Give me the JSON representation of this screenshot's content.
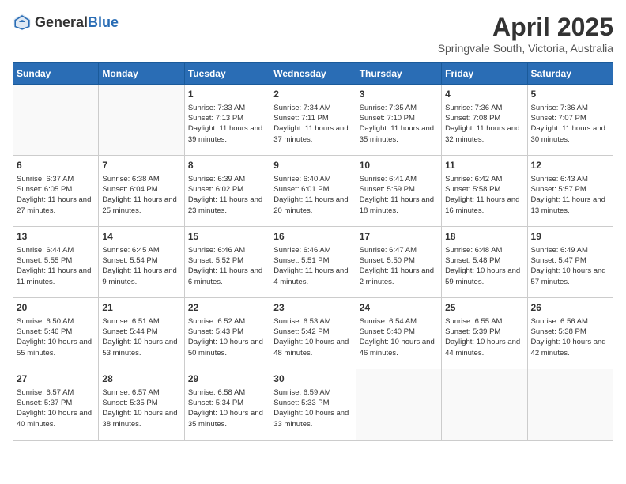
{
  "header": {
    "logo_general": "General",
    "logo_blue": "Blue",
    "month_title": "April 2025",
    "subtitle": "Springvale South, Victoria, Australia"
  },
  "days_of_week": [
    "Sunday",
    "Monday",
    "Tuesday",
    "Wednesday",
    "Thursday",
    "Friday",
    "Saturday"
  ],
  "weeks": [
    [
      {
        "day": "",
        "sunrise": "",
        "sunset": "",
        "daylight": "",
        "empty": true
      },
      {
        "day": "",
        "sunrise": "",
        "sunset": "",
        "daylight": "",
        "empty": true
      },
      {
        "day": "1",
        "sunrise": "Sunrise: 7:33 AM",
        "sunset": "Sunset: 7:13 PM",
        "daylight": "Daylight: 11 hours and 39 minutes.",
        "empty": false
      },
      {
        "day": "2",
        "sunrise": "Sunrise: 7:34 AM",
        "sunset": "Sunset: 7:11 PM",
        "daylight": "Daylight: 11 hours and 37 minutes.",
        "empty": false
      },
      {
        "day": "3",
        "sunrise": "Sunrise: 7:35 AM",
        "sunset": "Sunset: 7:10 PM",
        "daylight": "Daylight: 11 hours and 35 minutes.",
        "empty": false
      },
      {
        "day": "4",
        "sunrise": "Sunrise: 7:36 AM",
        "sunset": "Sunset: 7:08 PM",
        "daylight": "Daylight: 11 hours and 32 minutes.",
        "empty": false
      },
      {
        "day": "5",
        "sunrise": "Sunrise: 7:36 AM",
        "sunset": "Sunset: 7:07 PM",
        "daylight": "Daylight: 11 hours and 30 minutes.",
        "empty": false
      }
    ],
    [
      {
        "day": "6",
        "sunrise": "Sunrise: 6:37 AM",
        "sunset": "Sunset: 6:05 PM",
        "daylight": "Daylight: 11 hours and 27 minutes.",
        "empty": false
      },
      {
        "day": "7",
        "sunrise": "Sunrise: 6:38 AM",
        "sunset": "Sunset: 6:04 PM",
        "daylight": "Daylight: 11 hours and 25 minutes.",
        "empty": false
      },
      {
        "day": "8",
        "sunrise": "Sunrise: 6:39 AM",
        "sunset": "Sunset: 6:02 PM",
        "daylight": "Daylight: 11 hours and 23 minutes.",
        "empty": false
      },
      {
        "day": "9",
        "sunrise": "Sunrise: 6:40 AM",
        "sunset": "Sunset: 6:01 PM",
        "daylight": "Daylight: 11 hours and 20 minutes.",
        "empty": false
      },
      {
        "day": "10",
        "sunrise": "Sunrise: 6:41 AM",
        "sunset": "Sunset: 5:59 PM",
        "daylight": "Daylight: 11 hours and 18 minutes.",
        "empty": false
      },
      {
        "day": "11",
        "sunrise": "Sunrise: 6:42 AM",
        "sunset": "Sunset: 5:58 PM",
        "daylight": "Daylight: 11 hours and 16 minutes.",
        "empty": false
      },
      {
        "day": "12",
        "sunrise": "Sunrise: 6:43 AM",
        "sunset": "Sunset: 5:57 PM",
        "daylight": "Daylight: 11 hours and 13 minutes.",
        "empty": false
      }
    ],
    [
      {
        "day": "13",
        "sunrise": "Sunrise: 6:44 AM",
        "sunset": "Sunset: 5:55 PM",
        "daylight": "Daylight: 11 hours and 11 minutes.",
        "empty": false
      },
      {
        "day": "14",
        "sunrise": "Sunrise: 6:45 AM",
        "sunset": "Sunset: 5:54 PM",
        "daylight": "Daylight: 11 hours and 9 minutes.",
        "empty": false
      },
      {
        "day": "15",
        "sunrise": "Sunrise: 6:46 AM",
        "sunset": "Sunset: 5:52 PM",
        "daylight": "Daylight: 11 hours and 6 minutes.",
        "empty": false
      },
      {
        "day": "16",
        "sunrise": "Sunrise: 6:46 AM",
        "sunset": "Sunset: 5:51 PM",
        "daylight": "Daylight: 11 hours and 4 minutes.",
        "empty": false
      },
      {
        "day": "17",
        "sunrise": "Sunrise: 6:47 AM",
        "sunset": "Sunset: 5:50 PM",
        "daylight": "Daylight: 11 hours and 2 minutes.",
        "empty": false
      },
      {
        "day": "18",
        "sunrise": "Sunrise: 6:48 AM",
        "sunset": "Sunset: 5:48 PM",
        "daylight": "Daylight: 10 hours and 59 minutes.",
        "empty": false
      },
      {
        "day": "19",
        "sunrise": "Sunrise: 6:49 AM",
        "sunset": "Sunset: 5:47 PM",
        "daylight": "Daylight: 10 hours and 57 minutes.",
        "empty": false
      }
    ],
    [
      {
        "day": "20",
        "sunrise": "Sunrise: 6:50 AM",
        "sunset": "Sunset: 5:46 PM",
        "daylight": "Daylight: 10 hours and 55 minutes.",
        "empty": false
      },
      {
        "day": "21",
        "sunrise": "Sunrise: 6:51 AM",
        "sunset": "Sunset: 5:44 PM",
        "daylight": "Daylight: 10 hours and 53 minutes.",
        "empty": false
      },
      {
        "day": "22",
        "sunrise": "Sunrise: 6:52 AM",
        "sunset": "Sunset: 5:43 PM",
        "daylight": "Daylight: 10 hours and 50 minutes.",
        "empty": false
      },
      {
        "day": "23",
        "sunrise": "Sunrise: 6:53 AM",
        "sunset": "Sunset: 5:42 PM",
        "daylight": "Daylight: 10 hours and 48 minutes.",
        "empty": false
      },
      {
        "day": "24",
        "sunrise": "Sunrise: 6:54 AM",
        "sunset": "Sunset: 5:40 PM",
        "daylight": "Daylight: 10 hours and 46 minutes.",
        "empty": false
      },
      {
        "day": "25",
        "sunrise": "Sunrise: 6:55 AM",
        "sunset": "Sunset: 5:39 PM",
        "daylight": "Daylight: 10 hours and 44 minutes.",
        "empty": false
      },
      {
        "day": "26",
        "sunrise": "Sunrise: 6:56 AM",
        "sunset": "Sunset: 5:38 PM",
        "daylight": "Daylight: 10 hours and 42 minutes.",
        "empty": false
      }
    ],
    [
      {
        "day": "27",
        "sunrise": "Sunrise: 6:57 AM",
        "sunset": "Sunset: 5:37 PM",
        "daylight": "Daylight: 10 hours and 40 minutes.",
        "empty": false
      },
      {
        "day": "28",
        "sunrise": "Sunrise: 6:57 AM",
        "sunset": "Sunset: 5:35 PM",
        "daylight": "Daylight: 10 hours and 38 minutes.",
        "empty": false
      },
      {
        "day": "29",
        "sunrise": "Sunrise: 6:58 AM",
        "sunset": "Sunset: 5:34 PM",
        "daylight": "Daylight: 10 hours and 35 minutes.",
        "empty": false
      },
      {
        "day": "30",
        "sunrise": "Sunrise: 6:59 AM",
        "sunset": "Sunset: 5:33 PM",
        "daylight": "Daylight: 10 hours and 33 minutes.",
        "empty": false
      },
      {
        "day": "",
        "sunrise": "",
        "sunset": "",
        "daylight": "",
        "empty": true
      },
      {
        "day": "",
        "sunrise": "",
        "sunset": "",
        "daylight": "",
        "empty": true
      },
      {
        "day": "",
        "sunrise": "",
        "sunset": "",
        "daylight": "",
        "empty": true
      }
    ]
  ]
}
